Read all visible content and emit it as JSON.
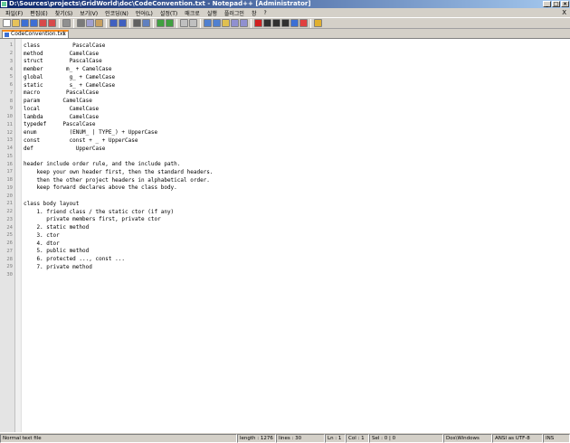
{
  "window": {
    "title": "D:\\Sources\\projects\\GridWorld\\doc\\CodeConvention.txt - Notepad++ [Administrator]",
    "min_label": "_",
    "max_label": "□",
    "close_label": "×"
  },
  "menu": {
    "items": [
      "파일(F)",
      "편집(E)",
      "찾기(S)",
      "보기(V)",
      "인코딩(N)",
      "언어(L)",
      "설정(T)",
      "매크로",
      "실행",
      "플러그인",
      "창",
      "?"
    ],
    "close_label": "X"
  },
  "toolbar": {
    "buttons": [
      {
        "name": "new-file-icon",
        "color": "#ffffff"
      },
      {
        "name": "open-file-icon",
        "color": "#e6c25a"
      },
      {
        "name": "save-icon",
        "color": "#3c6fd4"
      },
      {
        "name": "save-all-icon",
        "color": "#3c6fd4"
      },
      {
        "name": "close-icon",
        "color": "#d84a4a"
      },
      {
        "name": "close-all-icon",
        "color": "#d84a4a"
      },
      {
        "name": "print-icon",
        "color": "#909090"
      },
      {
        "name": "cut-icon",
        "color": "#7a7a7a"
      },
      {
        "name": "copy-icon",
        "color": "#a0a0d0"
      },
      {
        "name": "paste-icon",
        "color": "#c8a060"
      },
      {
        "name": "undo-icon",
        "color": "#4060c0"
      },
      {
        "name": "redo-icon",
        "color": "#4060c0"
      },
      {
        "name": "find-icon",
        "color": "#606060"
      },
      {
        "name": "replace-icon",
        "color": "#6080c0"
      },
      {
        "name": "zoom-in-icon",
        "color": "#40a040"
      },
      {
        "name": "zoom-out-icon",
        "color": "#40a040"
      },
      {
        "name": "sync-v-icon",
        "color": "#c0c0c0"
      },
      {
        "name": "sync-h-icon",
        "color": "#c0c0c0"
      },
      {
        "name": "wrap-icon",
        "color": "#5080d0"
      },
      {
        "name": "all-chars-icon",
        "color": "#5080d0"
      },
      {
        "name": "indent-guide-icon",
        "color": "#e0c050"
      },
      {
        "name": "udl-icon",
        "color": "#9090d0"
      },
      {
        "name": "doc-map-icon",
        "color": "#9090d0"
      },
      {
        "name": "record-macro-icon",
        "color": "#d02020"
      },
      {
        "name": "stop-macro-icon",
        "color": "#303030"
      },
      {
        "name": "play-macro-icon",
        "color": "#303030"
      },
      {
        "name": "play-multi-icon",
        "color": "#303030"
      },
      {
        "name": "save-macro-icon",
        "color": "#3c6fd4"
      },
      {
        "name": "spellcheck-icon",
        "color": "#e04040"
      },
      {
        "name": "plugin-icon",
        "color": "#e0b030"
      }
    ]
  },
  "tab": {
    "label": "CodeConvention.txt",
    "close_label": "x"
  },
  "editor": {
    "lines": [
      {
        "n": "1",
        "text": "class          PascalCase"
      },
      {
        "n": "2",
        "text": "method        CamelCase"
      },
      {
        "n": "3",
        "text": "struct        PascalCase"
      },
      {
        "n": "4",
        "text": "member       m_ + CamelCase"
      },
      {
        "n": "5",
        "text": "global        g_ + CamelCase"
      },
      {
        "name": "",
        "n": "6",
        "text": "static        s_ + CamelCase"
      },
      {
        "n": "7",
        "text": "macro        PascalCase"
      },
      {
        "n": "8",
        "text": "param       CamelCase"
      },
      {
        "n": "9",
        "text": "local         CamelCase"
      },
      {
        "n": "10",
        "text": "lambda        CamelCase"
      },
      {
        "n": "11",
        "text": "typedef     PascalCase"
      },
      {
        "n": "12",
        "text": "enum          (ENUM_ | TYPE_) + UpperCase"
      },
      {
        "n": "13",
        "text": "const         const + _ + UpperCase"
      },
      {
        "n": "14",
        "text": "def             UpperCase"
      },
      {
        "n": "15",
        "text": ""
      },
      {
        "n": "16",
        "text": "header include order rule, and the include path."
      },
      {
        "n": "17",
        "text": "    keep your own header first, then the standard headers."
      },
      {
        "n": "18",
        "text": "    then the other project headers in alphabetical order."
      },
      {
        "n": "19",
        "text": "    keep forward declares above the class body."
      },
      {
        "n": "20",
        "text": ""
      },
      {
        "n": "21",
        "text": "class body layout"
      },
      {
        "n": "22",
        "text": "    1. friend class / the static ctor (if any)"
      },
      {
        "n": "23",
        "text": "       private members first, private ctor"
      },
      {
        "n": "24",
        "text": "    2. static method"
      },
      {
        "n": "25",
        "text": "    3. ctor"
      },
      {
        "n": "26",
        "text": "    4. dtor"
      },
      {
        "n": "27",
        "text": "    5. public method"
      },
      {
        "n": "28",
        "text": "    6. protected ..., const ..."
      },
      {
        "n": "29",
        "text": "    7. private method"
      },
      {
        "n": "30",
        "text": ""
      }
    ]
  },
  "status": {
    "mode": "Normal text file",
    "length": "length : 1276",
    "lines": "lines : 30",
    "ln": "Ln : 1",
    "col": "Col : 1",
    "sel": "Sel : 0 | 0",
    "eol": "Dos\\Windows",
    "encoding": "ANSI as UTF-8",
    "ins": "INS"
  }
}
